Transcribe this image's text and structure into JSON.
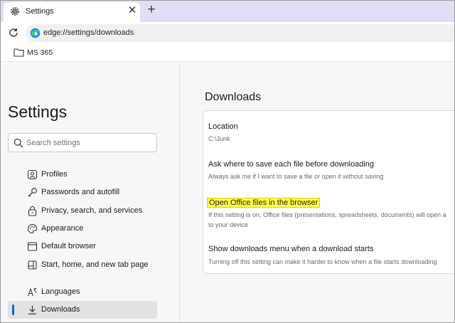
{
  "tab": {
    "title": "Settings",
    "icon": "gear-icon",
    "close_glyph": "✕",
    "new_tab_glyph": "+"
  },
  "address_bar": {
    "url": "edge://settings/downloads",
    "refresh_icon": "refresh-icon",
    "site_icon": "edge-logo-icon"
  },
  "favorites": {
    "items": [
      {
        "label": "MS 365",
        "icon": "folder-icon"
      }
    ]
  },
  "sidebar": {
    "title": "Settings",
    "search": {
      "placeholder": "Search settings",
      "value": ""
    },
    "items": [
      {
        "label": "Profiles",
        "icon": "profile-icon",
        "active": false
      },
      {
        "label": "Passwords and autofill",
        "icon": "key-icon",
        "active": false
      },
      {
        "label": "Privacy, search, and services",
        "icon": "lock-icon",
        "active": false
      },
      {
        "label": "Appearance",
        "icon": "appearance-icon",
        "active": false
      },
      {
        "label": "Default browser",
        "icon": "browser-icon",
        "active": false
      },
      {
        "label": "Start, home, and new tab page",
        "icon": "home-icon",
        "active": false
      },
      {
        "label": "Languages",
        "icon": "languages-icon",
        "active": false
      },
      {
        "label": "Downloads",
        "icon": "download-icon",
        "active": true
      }
    ]
  },
  "main": {
    "title": "Downloads",
    "settings": [
      {
        "title": "Location",
        "desc_lines": [
          "C:\\Junk"
        ]
      },
      {
        "title": "Ask where to save each file before downloading",
        "desc_lines": [
          "Always ask me if I want to save a file or open it without saving"
        ]
      },
      {
        "title": "Open Office files in the browser",
        "highlighted": true,
        "desc_lines": [
          "If this setting is on, Office files (presentations, spreadsheets, documents) will open a",
          "to your device"
        ]
      },
      {
        "title": "Show downloads menu when a download starts",
        "desc_lines": [
          "Turning off this setting can make it harder to know when a file starts downloading"
        ]
      }
    ]
  },
  "colors": {
    "tab_strip": "#e3dcf5",
    "accent": "#1b5fd1",
    "highlight": "#ffff4a"
  }
}
